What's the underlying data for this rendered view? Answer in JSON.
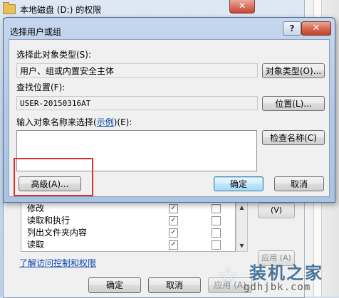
{
  "background_window": {
    "title": "本地磁盘 (D:) 的权限",
    "close_glyph": "✕",
    "permissions": [
      {
        "name": "修改",
        "allow": true,
        "deny": false
      },
      {
        "name": "读取和执行",
        "allow": true,
        "deny": false
      },
      {
        "name": "列出文件夹内容",
        "allow": true,
        "deny": false
      },
      {
        "name": "读取",
        "allow": true,
        "deny": false
      }
    ],
    "side_button_1": "(V)",
    "side_button_2": "应用 (A)",
    "link": "了解访问控制和权限",
    "buttons": {
      "ok": "确定",
      "cancel": "取消",
      "apply": "应用 (A)"
    }
  },
  "dialog": {
    "title": "选择用户或组",
    "help_glyph": "?",
    "close_glyph": "✕",
    "object_type_label": "选择此对象类型(S):",
    "object_type_value": "用户、组或内置安全主体",
    "object_type_button": "对象类型(O)...",
    "location_label": "查找位置(F):",
    "location_value": "USER-20150316AT",
    "location_button": "位置(L)...",
    "names_label_prefix": "输入对象名称来选择(",
    "names_label_link": "示例",
    "names_label_suffix": ")(E):",
    "names_value": "",
    "check_names_button": "检查名称(C)",
    "advanced_button": "高级(A)...",
    "ok_button": "确定",
    "cancel_button": "取消"
  },
  "watermark": {
    "title": "装机之家",
    "url": "gdhjbk.com"
  },
  "colors": {
    "highlight_box": "#e0302e",
    "link": "#0645ad",
    "title_bar": "#b2c9e6"
  }
}
